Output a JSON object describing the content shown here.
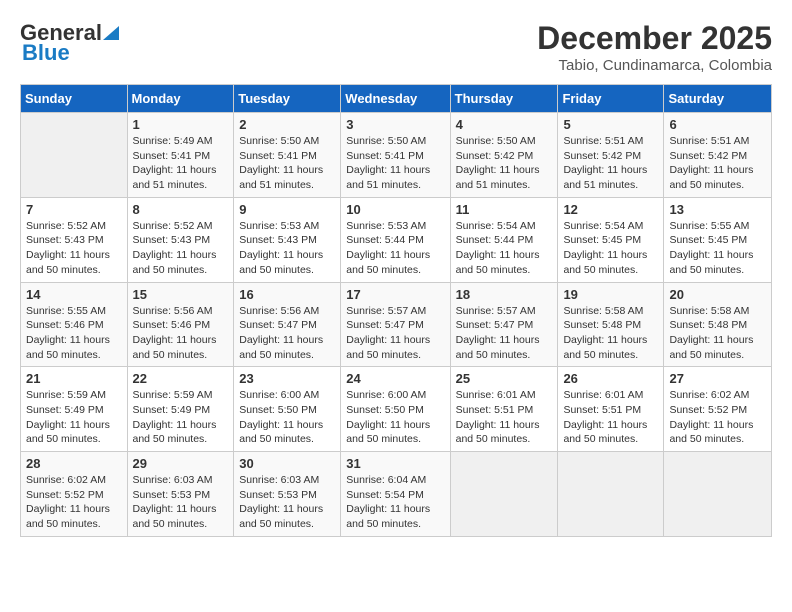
{
  "logo": {
    "general": "General",
    "blue": "Blue"
  },
  "title": {
    "month_year": "December 2025",
    "location": "Tabio, Cundinamarca, Colombia"
  },
  "days_of_week": [
    "Sunday",
    "Monday",
    "Tuesday",
    "Wednesday",
    "Thursday",
    "Friday",
    "Saturday"
  ],
  "weeks": [
    [
      {
        "day": "",
        "info": ""
      },
      {
        "day": "1",
        "info": "Sunrise: 5:49 AM\nSunset: 5:41 PM\nDaylight: 11 hours\nand 51 minutes."
      },
      {
        "day": "2",
        "info": "Sunrise: 5:50 AM\nSunset: 5:41 PM\nDaylight: 11 hours\nand 51 minutes."
      },
      {
        "day": "3",
        "info": "Sunrise: 5:50 AM\nSunset: 5:41 PM\nDaylight: 11 hours\nand 51 minutes."
      },
      {
        "day": "4",
        "info": "Sunrise: 5:50 AM\nSunset: 5:42 PM\nDaylight: 11 hours\nand 51 minutes."
      },
      {
        "day": "5",
        "info": "Sunrise: 5:51 AM\nSunset: 5:42 PM\nDaylight: 11 hours\nand 51 minutes."
      },
      {
        "day": "6",
        "info": "Sunrise: 5:51 AM\nSunset: 5:42 PM\nDaylight: 11 hours\nand 50 minutes."
      }
    ],
    [
      {
        "day": "7",
        "info": "Sunrise: 5:52 AM\nSunset: 5:43 PM\nDaylight: 11 hours\nand 50 minutes."
      },
      {
        "day": "8",
        "info": "Sunrise: 5:52 AM\nSunset: 5:43 PM\nDaylight: 11 hours\nand 50 minutes."
      },
      {
        "day": "9",
        "info": "Sunrise: 5:53 AM\nSunset: 5:43 PM\nDaylight: 11 hours\nand 50 minutes."
      },
      {
        "day": "10",
        "info": "Sunrise: 5:53 AM\nSunset: 5:44 PM\nDaylight: 11 hours\nand 50 minutes."
      },
      {
        "day": "11",
        "info": "Sunrise: 5:54 AM\nSunset: 5:44 PM\nDaylight: 11 hours\nand 50 minutes."
      },
      {
        "day": "12",
        "info": "Sunrise: 5:54 AM\nSunset: 5:45 PM\nDaylight: 11 hours\nand 50 minutes."
      },
      {
        "day": "13",
        "info": "Sunrise: 5:55 AM\nSunset: 5:45 PM\nDaylight: 11 hours\nand 50 minutes."
      }
    ],
    [
      {
        "day": "14",
        "info": "Sunrise: 5:55 AM\nSunset: 5:46 PM\nDaylight: 11 hours\nand 50 minutes."
      },
      {
        "day": "15",
        "info": "Sunrise: 5:56 AM\nSunset: 5:46 PM\nDaylight: 11 hours\nand 50 minutes."
      },
      {
        "day": "16",
        "info": "Sunrise: 5:56 AM\nSunset: 5:47 PM\nDaylight: 11 hours\nand 50 minutes."
      },
      {
        "day": "17",
        "info": "Sunrise: 5:57 AM\nSunset: 5:47 PM\nDaylight: 11 hours\nand 50 minutes."
      },
      {
        "day": "18",
        "info": "Sunrise: 5:57 AM\nSunset: 5:47 PM\nDaylight: 11 hours\nand 50 minutes."
      },
      {
        "day": "19",
        "info": "Sunrise: 5:58 AM\nSunset: 5:48 PM\nDaylight: 11 hours\nand 50 minutes."
      },
      {
        "day": "20",
        "info": "Sunrise: 5:58 AM\nSunset: 5:48 PM\nDaylight: 11 hours\nand 50 minutes."
      }
    ],
    [
      {
        "day": "21",
        "info": "Sunrise: 5:59 AM\nSunset: 5:49 PM\nDaylight: 11 hours\nand 50 minutes."
      },
      {
        "day": "22",
        "info": "Sunrise: 5:59 AM\nSunset: 5:49 PM\nDaylight: 11 hours\nand 50 minutes."
      },
      {
        "day": "23",
        "info": "Sunrise: 6:00 AM\nSunset: 5:50 PM\nDaylight: 11 hours\nand 50 minutes."
      },
      {
        "day": "24",
        "info": "Sunrise: 6:00 AM\nSunset: 5:50 PM\nDaylight: 11 hours\nand 50 minutes."
      },
      {
        "day": "25",
        "info": "Sunrise: 6:01 AM\nSunset: 5:51 PM\nDaylight: 11 hours\nand 50 minutes."
      },
      {
        "day": "26",
        "info": "Sunrise: 6:01 AM\nSunset: 5:51 PM\nDaylight: 11 hours\nand 50 minutes."
      },
      {
        "day": "27",
        "info": "Sunrise: 6:02 AM\nSunset: 5:52 PM\nDaylight: 11 hours\nand 50 minutes."
      }
    ],
    [
      {
        "day": "28",
        "info": "Sunrise: 6:02 AM\nSunset: 5:52 PM\nDaylight: 11 hours\nand 50 minutes."
      },
      {
        "day": "29",
        "info": "Sunrise: 6:03 AM\nSunset: 5:53 PM\nDaylight: 11 hours\nand 50 minutes."
      },
      {
        "day": "30",
        "info": "Sunrise: 6:03 AM\nSunset: 5:53 PM\nDaylight: 11 hours\nand 50 minutes."
      },
      {
        "day": "31",
        "info": "Sunrise: 6:04 AM\nSunset: 5:54 PM\nDaylight: 11 hours\nand 50 minutes."
      },
      {
        "day": "",
        "info": ""
      },
      {
        "day": "",
        "info": ""
      },
      {
        "day": "",
        "info": ""
      }
    ]
  ]
}
